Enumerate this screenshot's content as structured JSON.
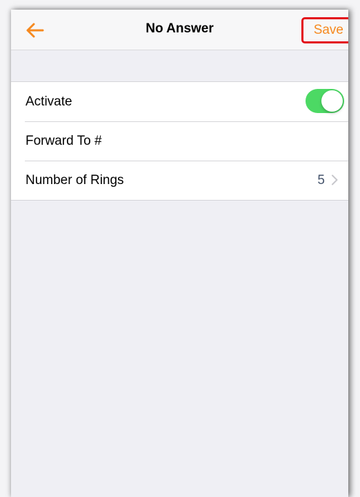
{
  "navbar": {
    "back_icon": "arrow-left-icon",
    "title": "No Answer",
    "save_label": "Save",
    "accent_color": "#f6891f",
    "highlight_color": "#e30613"
  },
  "settings": {
    "activate": {
      "label": "Activate",
      "toggle_on": true,
      "toggle_color": "#4cd964"
    },
    "forward_to": {
      "label": "Forward To #",
      "value": ""
    },
    "number_of_rings": {
      "label": "Number of Rings",
      "value": "5",
      "chevron_icon": "chevron-right-icon"
    }
  }
}
